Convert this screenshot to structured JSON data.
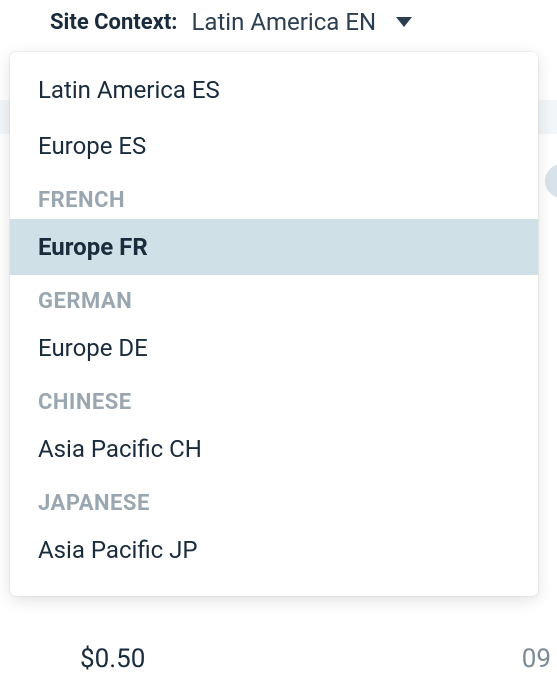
{
  "header": {
    "label": "Site Context:",
    "value": "Latin America EN"
  },
  "dropdown": {
    "items": [
      {
        "type": "option",
        "label": "Latin America ES",
        "selected": false
      },
      {
        "type": "option",
        "label": "Europe ES",
        "selected": false
      },
      {
        "type": "group",
        "label": "FRENCH"
      },
      {
        "type": "option",
        "label": "Europe FR",
        "selected": true
      },
      {
        "type": "group",
        "label": "GERMAN"
      },
      {
        "type": "option",
        "label": "Europe DE",
        "selected": false
      },
      {
        "type": "group",
        "label": "CHINESE"
      },
      {
        "type": "option",
        "label": "Asia Pacific CH",
        "selected": false
      },
      {
        "type": "group",
        "label": "JAPANESE"
      },
      {
        "type": "option",
        "label": "Asia Pacific JP",
        "selected": false
      }
    ]
  },
  "background": {
    "price": "$0.50",
    "id_fragment": "09"
  }
}
